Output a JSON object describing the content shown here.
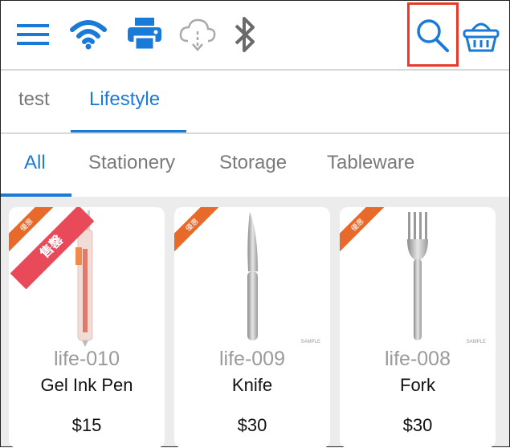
{
  "toolbar": {
    "icons": [
      "menu-icon",
      "wifi-icon",
      "printer-icon",
      "cloud-download-icon",
      "bluetooth-icon",
      "search-icon",
      "basket-icon"
    ],
    "accent": "#1a7ad8",
    "highlight_color": "#e8392b"
  },
  "categories": [
    {
      "label": "test",
      "active": false
    },
    {
      "label": "Lifestyle",
      "active": true
    }
  ],
  "subcategories": [
    {
      "label": "All",
      "active": true
    },
    {
      "label": "Stationery",
      "active": false
    },
    {
      "label": "Storage",
      "active": false
    },
    {
      "label": "Tableware",
      "active": false
    }
  ],
  "products": [
    {
      "sku": "life-010",
      "name": "Gel Ink Pen",
      "price": "$15",
      "badge": "優惠",
      "badge2": "售罄",
      "image": "pen-icon"
    },
    {
      "sku": "life-009",
      "name": "Knife",
      "price": "$30",
      "badge": "優惠",
      "watermark": "SAMPLE",
      "image": "knife-icon"
    },
    {
      "sku": "life-008",
      "name": "Fork",
      "price": "$30",
      "badge": "優惠",
      "watermark": "SAMPLE",
      "image": "fork-icon"
    }
  ]
}
